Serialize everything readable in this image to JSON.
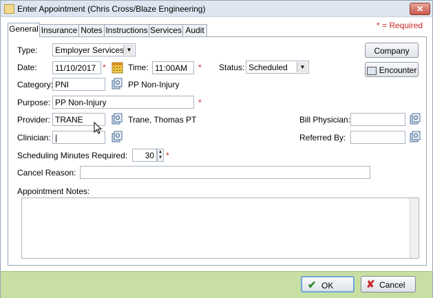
{
  "window": {
    "title": "Enter Appointment (Chris Cross/Blaze Engineering)",
    "close_label": "✕"
  },
  "tabs": [
    {
      "label": "General"
    },
    {
      "label": "Insurance"
    },
    {
      "label": "Notes"
    },
    {
      "label": "Instructions"
    },
    {
      "label": "Services"
    },
    {
      "label": "Audit"
    }
  ],
  "required_note": "* = Required",
  "form": {
    "type": {
      "label": "Type:",
      "value": "Employer Services"
    },
    "date": {
      "label": "Date:",
      "value": "11/10/2017"
    },
    "time": {
      "label": "Time:",
      "value": "11:00AM"
    },
    "status": {
      "label": "Status:",
      "value": "Scheduled"
    },
    "category": {
      "label": "Category:",
      "value": "PNI",
      "description": "PP Non-Injury"
    },
    "purpose": {
      "label": "Purpose:",
      "value": "PP Non-Injury"
    },
    "provider": {
      "label": "Provider:",
      "value": "TRANE",
      "description": "Trane, Thomas  PT"
    },
    "clinician": {
      "label": "Clinician:",
      "value": "|"
    },
    "bill_physician": {
      "label": "Bill Physician:",
      "value": ""
    },
    "referred_by": {
      "label": "Referred By:",
      "value": ""
    },
    "sched_minutes": {
      "label": "Scheduling Minutes Required:",
      "value": "30"
    },
    "cancel_reason": {
      "label": "Cancel Reason:",
      "value": ""
    },
    "appt_notes": {
      "label": "Appointment Notes:",
      "value": ""
    },
    "required_mark": "*"
  },
  "side_buttons": {
    "company": "Company",
    "encounter": "Encounter"
  },
  "footer": {
    "ok": "OK",
    "cancel": "Cancel"
  },
  "colors": {
    "required": "#cc2222",
    "footer_bg": "#c8dfa3"
  }
}
